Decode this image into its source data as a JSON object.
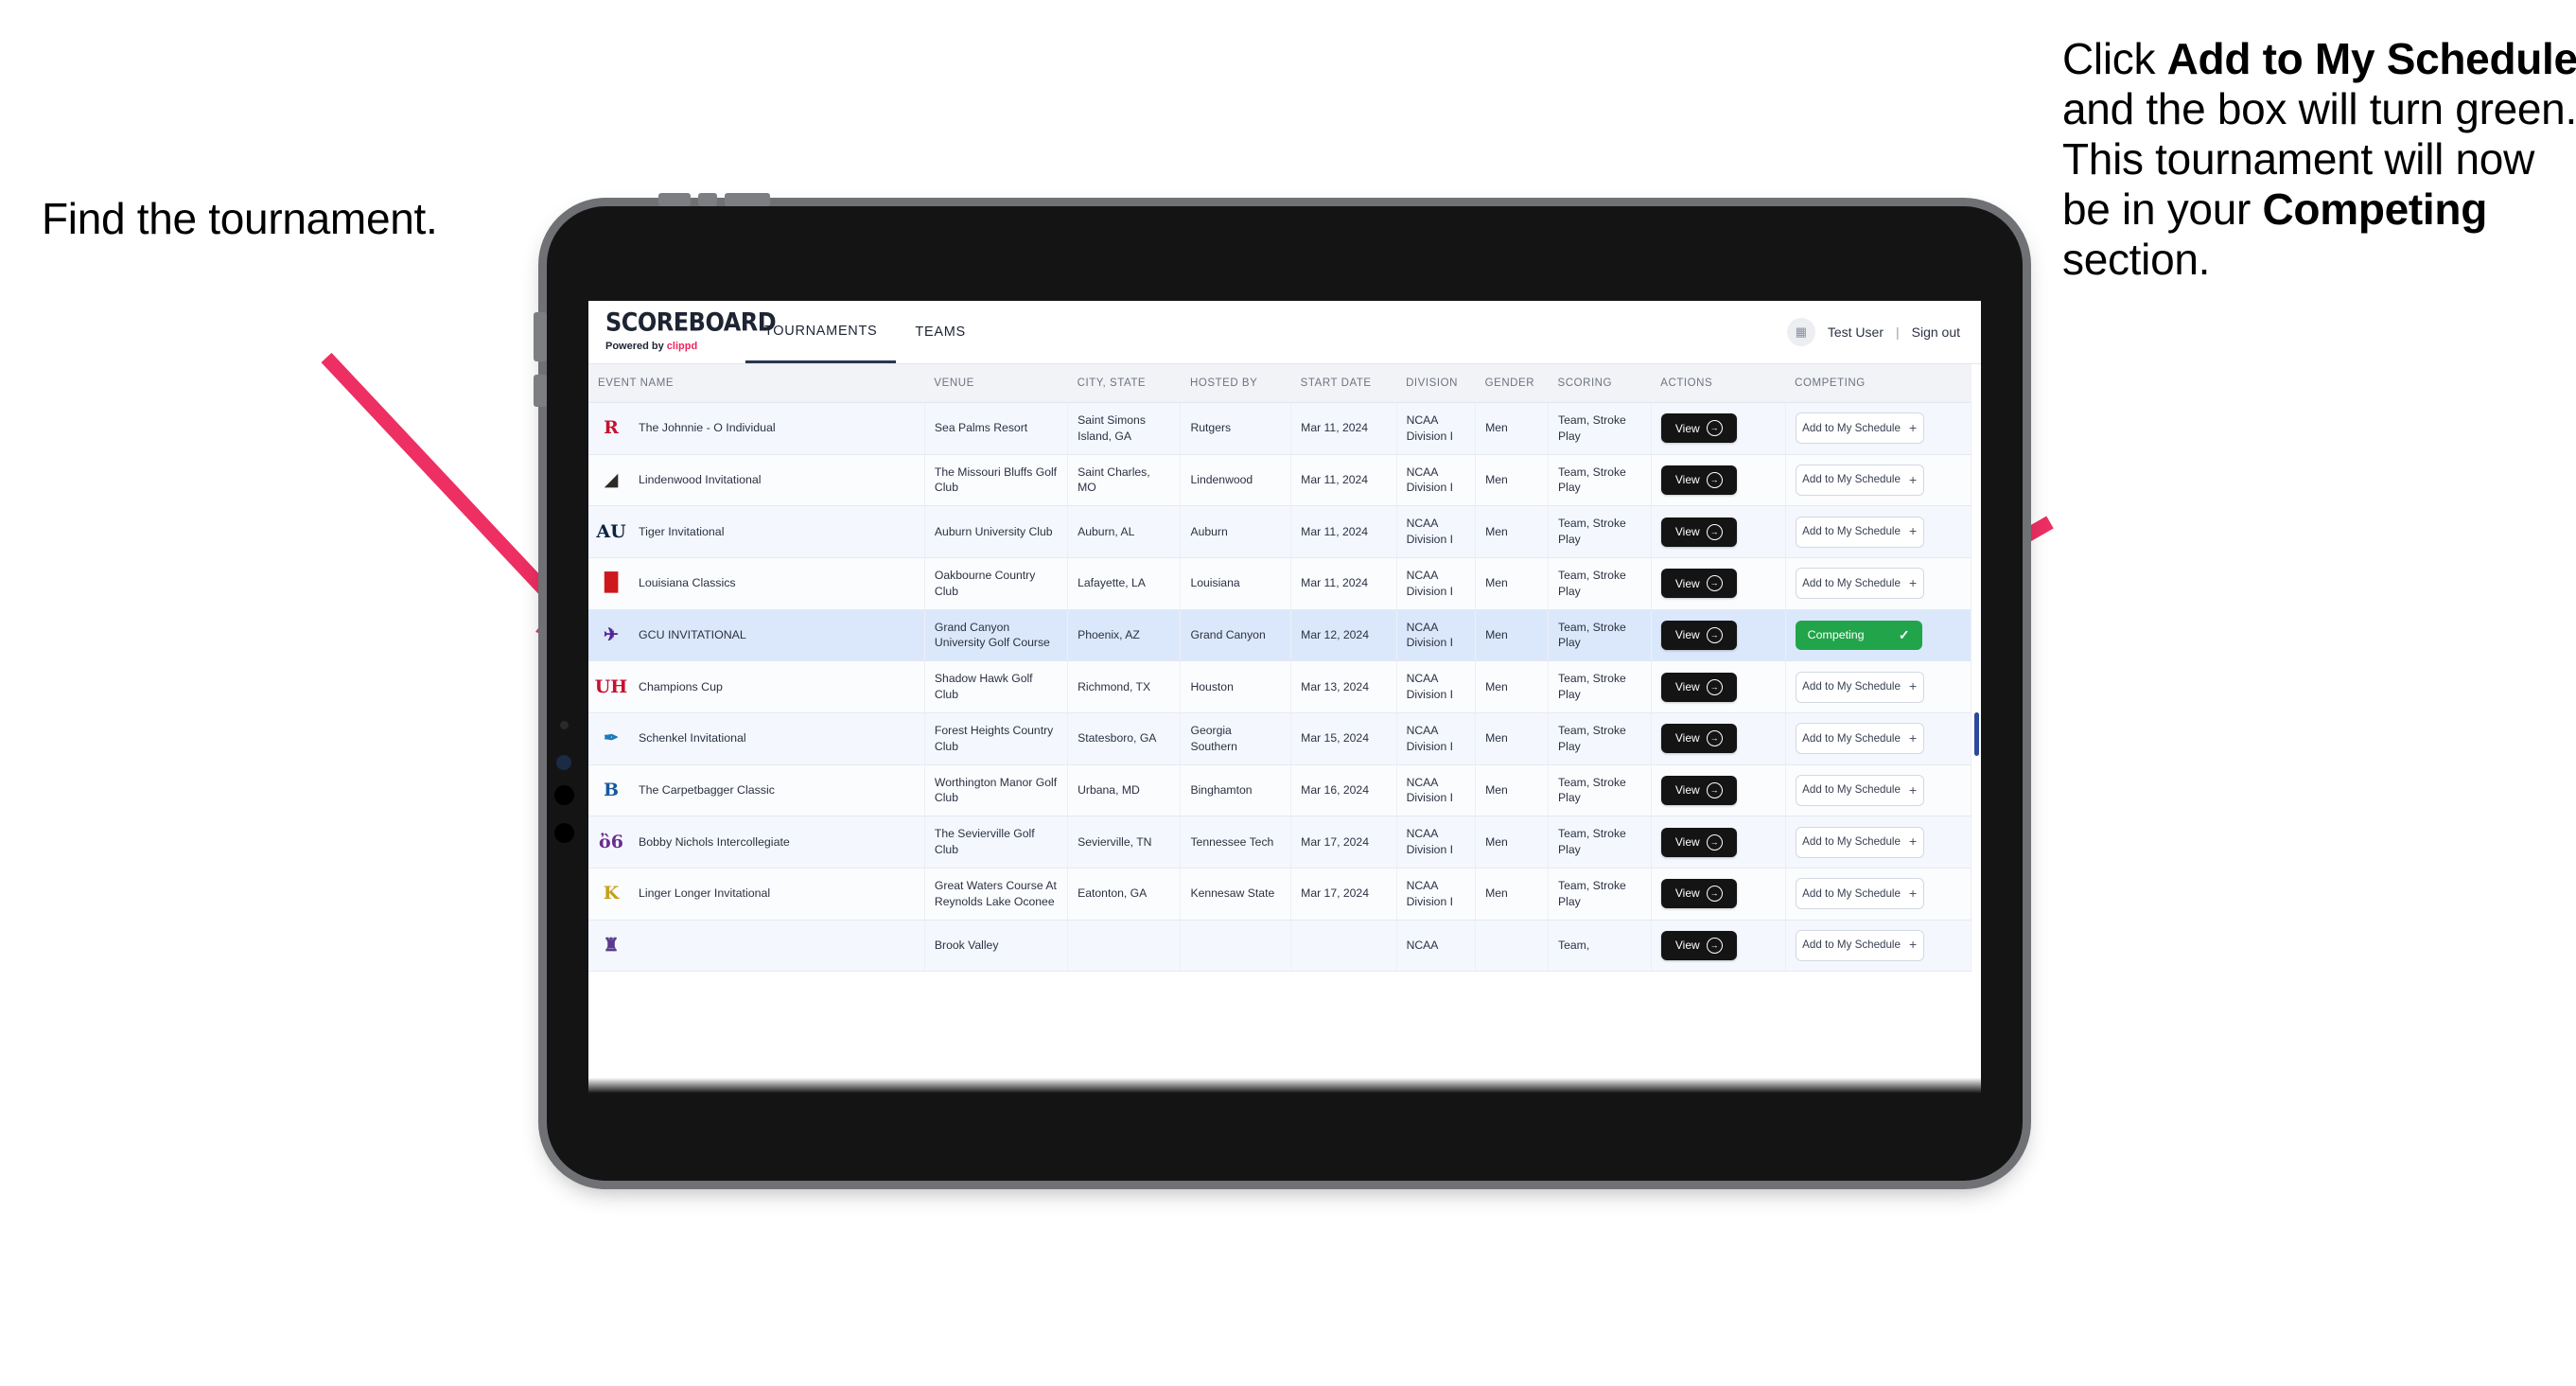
{
  "annotations": {
    "left": "Find the tournament.",
    "right_parts": [
      {
        "t": "Click ",
        "b": false
      },
      {
        "t": "Add to My Schedule",
        "b": true
      },
      {
        "t": " and the box will turn green. This tournament will now be in your ",
        "b": false
      },
      {
        "t": "Competing",
        "b": true
      },
      {
        "t": " section.",
        "b": false
      }
    ],
    "arrow_color": "#ed2f63"
  },
  "app": {
    "brand": {
      "word": "SCOREBOARD",
      "powered_prefix": "Powered by ",
      "powered_name": "clippd"
    },
    "nav": [
      {
        "label": "TOURNAMENTS",
        "active": true
      },
      {
        "label": "TEAMS",
        "active": false
      }
    ],
    "account": {
      "avatar_icon": "user-avatar-icon",
      "user": "Test User",
      "separator": "|",
      "signout": "Sign out"
    },
    "table": {
      "columns": [
        "EVENT NAME",
        "VENUE",
        "CITY, STATE",
        "HOSTED BY",
        "START DATE",
        "DIVISION",
        "GENDER",
        "SCORING",
        "ACTIONS",
        "COMPETING"
      ],
      "view_label": "View",
      "add_label": "Add to My Schedule",
      "competing_label": "Competing",
      "rows": [
        {
          "name": "The Johnnie - O Individual",
          "venue": "Sea Palms Resort",
          "city": "Saint Simons Island, GA",
          "host": "Rutgers",
          "date": "Mar 11, 2024",
          "division": "NCAA Division I",
          "gender": "Men",
          "scoring": "Team, Stroke Play",
          "competing": false,
          "logo_text": "R",
          "logo_color": "#c41230"
        },
        {
          "name": "Lindenwood Invitational",
          "venue": "The Missouri Bluffs Golf Club",
          "city": "Saint Charles, MO",
          "host": "Lindenwood",
          "date": "Mar 11, 2024",
          "division": "NCAA Division I",
          "gender": "Men",
          "scoring": "Team, Stroke Play",
          "competing": false,
          "logo_text": "◢",
          "logo_color": "#2d2a26"
        },
        {
          "name": "Tiger Invitational",
          "venue": "Auburn University Club",
          "city": "Auburn, AL",
          "host": "Auburn",
          "date": "Mar 11, 2024",
          "division": "NCAA Division I",
          "gender": "Men",
          "scoring": "Team, Stroke Play",
          "competing": false,
          "logo_text": "AU",
          "logo_color": "#0c2340"
        },
        {
          "name": "Louisiana Classics",
          "venue": "Oakbourne Country Club",
          "city": "Lafayette, LA",
          "host": "Louisiana",
          "date": "Mar 11, 2024",
          "division": "NCAA Division I",
          "gender": "Men",
          "scoring": "Team, Stroke Play",
          "competing": false,
          "logo_text": "▐▌",
          "logo_color": "#ce181e"
        },
        {
          "name": "GCU INVITATIONAL",
          "venue": "Grand Canyon University Golf Course",
          "city": "Phoenix, AZ",
          "host": "Grand Canyon",
          "date": "Mar 12, 2024",
          "division": "NCAA Division I",
          "gender": "Men",
          "scoring": "Team, Stroke Play",
          "competing": true,
          "logo_text": "✈",
          "logo_color": "#522398"
        },
        {
          "name": "Champions Cup",
          "venue": "Shadow Hawk Golf Club",
          "city": "Richmond, TX",
          "host": "Houston",
          "date": "Mar 13, 2024",
          "division": "NCAA Division I",
          "gender": "Men",
          "scoring": "Team, Stroke Play",
          "competing": false,
          "logo_text": "UH",
          "logo_color": "#c8102e"
        },
        {
          "name": "Schenkel Invitational",
          "venue": "Forest Heights Country Club",
          "city": "Statesboro, GA",
          "host": "Georgia Southern",
          "date": "Mar 15, 2024",
          "division": "NCAA Division I",
          "gender": "Men",
          "scoring": "Team, Stroke Play",
          "competing": false,
          "logo_text": "✒",
          "logo_color": "#1e7ab8"
        },
        {
          "name": "The Carpetbagger Classic",
          "venue": "Worthington Manor Golf Club",
          "city": "Urbana, MD",
          "host": "Binghamton",
          "date": "Mar 16, 2024",
          "division": "NCAA Division I",
          "gender": "Men",
          "scoring": "Team, Stroke Play",
          "competing": false,
          "logo_text": "B",
          "logo_color": "#17589c"
        },
        {
          "name": "Bobby Nichols Intercollegiate",
          "venue": "The Sevierville Golf Club",
          "city": "Sevierville, TN",
          "host": "Tennessee Tech",
          "date": "Mar 17, 2024",
          "division": "NCAA Division I",
          "gender": "Men",
          "scoring": "Team, Stroke Play",
          "competing": false,
          "logo_text": "ὂ6",
          "logo_color": "#6a2c91"
        },
        {
          "name": "Linger Longer Invitational",
          "venue": "Great Waters Course At Reynolds Lake Oconee",
          "city": "Eatonton, GA",
          "host": "Kennesaw State",
          "date": "Mar 17, 2024",
          "division": "NCAA Division I",
          "gender": "Men",
          "scoring": "Team, Stroke Play",
          "competing": false,
          "logo_text": "K",
          "logo_color": "#c6a01b"
        },
        {
          "name": "",
          "venue": "Brook Valley",
          "city": "",
          "host": "",
          "date": "",
          "division": "NCAA",
          "gender": "",
          "scoring": "Team,",
          "competing": false,
          "logo_text": "♜",
          "logo_color": "#5b3a8e"
        }
      ]
    }
  }
}
